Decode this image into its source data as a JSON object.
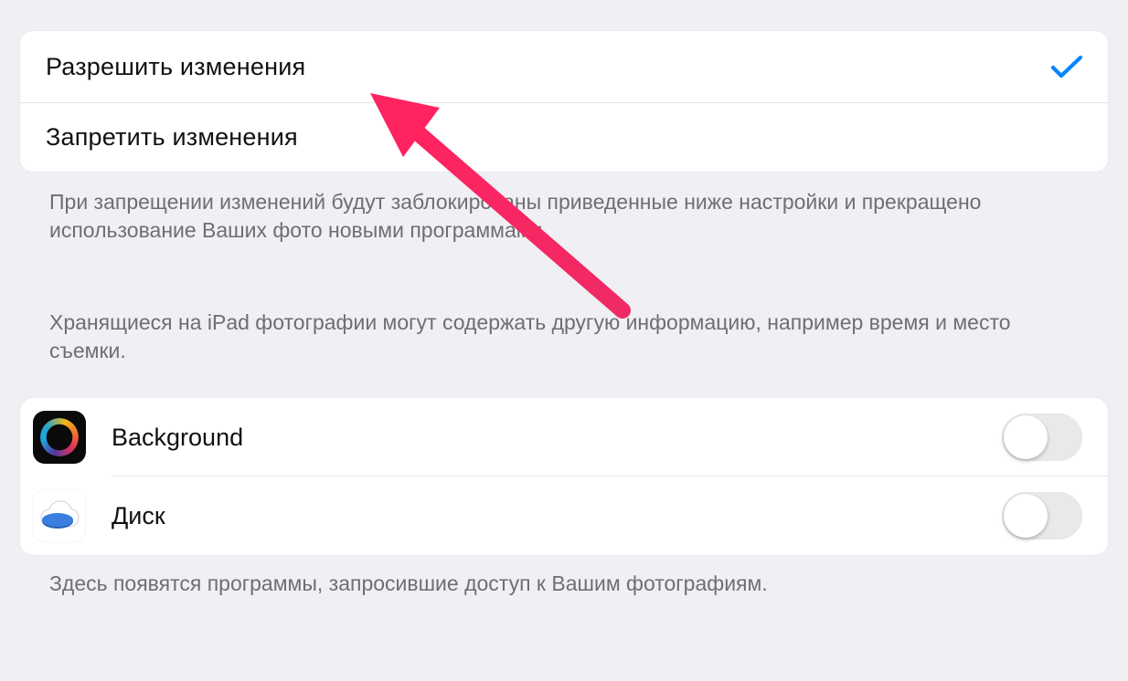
{
  "changes": {
    "allow_label": "Разрешить изменения",
    "deny_label": "Запретить изменения",
    "selected": "allow"
  },
  "footer": {
    "block_note": "При запрещении изменений будут заблокированы приведенные ниже настройки и прекращено использование Ваших фото новыми программами.",
    "photos_note": "Хранящиеся на iPad фотографии могут содержать другую информацию, например время и место съемки.",
    "apps_note": "Здесь появятся программы, запросившие доступ к Вашим фотографиям."
  },
  "apps": [
    {
      "name": "Background",
      "enabled": false
    },
    {
      "name": "Диск",
      "enabled": false
    }
  ],
  "colors": {
    "accent_check": "#0a84ff",
    "arrow": "#ef2a64"
  }
}
